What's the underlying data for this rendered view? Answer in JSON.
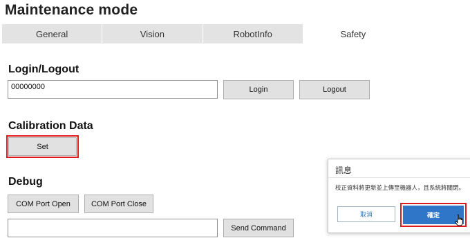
{
  "page": {
    "title": "Maintenance mode"
  },
  "tabs": [
    {
      "label": "General"
    },
    {
      "label": "Vision"
    },
    {
      "label": "RobotInfo"
    },
    {
      "label": "Safety"
    }
  ],
  "login": {
    "heading": "Login/Logout",
    "input_value": "00000000",
    "login_label": "Login",
    "logout_label": "Logout"
  },
  "calibration": {
    "heading": "Calibration Data",
    "set_label": "Set"
  },
  "debug": {
    "heading": "Debug",
    "com_open_label": "COM Port Open",
    "com_close_label": "COM Port Close",
    "command_value": "",
    "send_label": "Send Command"
  },
  "dialog": {
    "title": "訊息",
    "message": "校正資料將更新並上傳至機器人，且系統將關閉。",
    "cancel_label": "取消",
    "ok_label": "確定"
  },
  "colors": {
    "highlight": "#e0191c",
    "primary": "#2f76c9",
    "tab_bg": "#e3e3e3"
  }
}
